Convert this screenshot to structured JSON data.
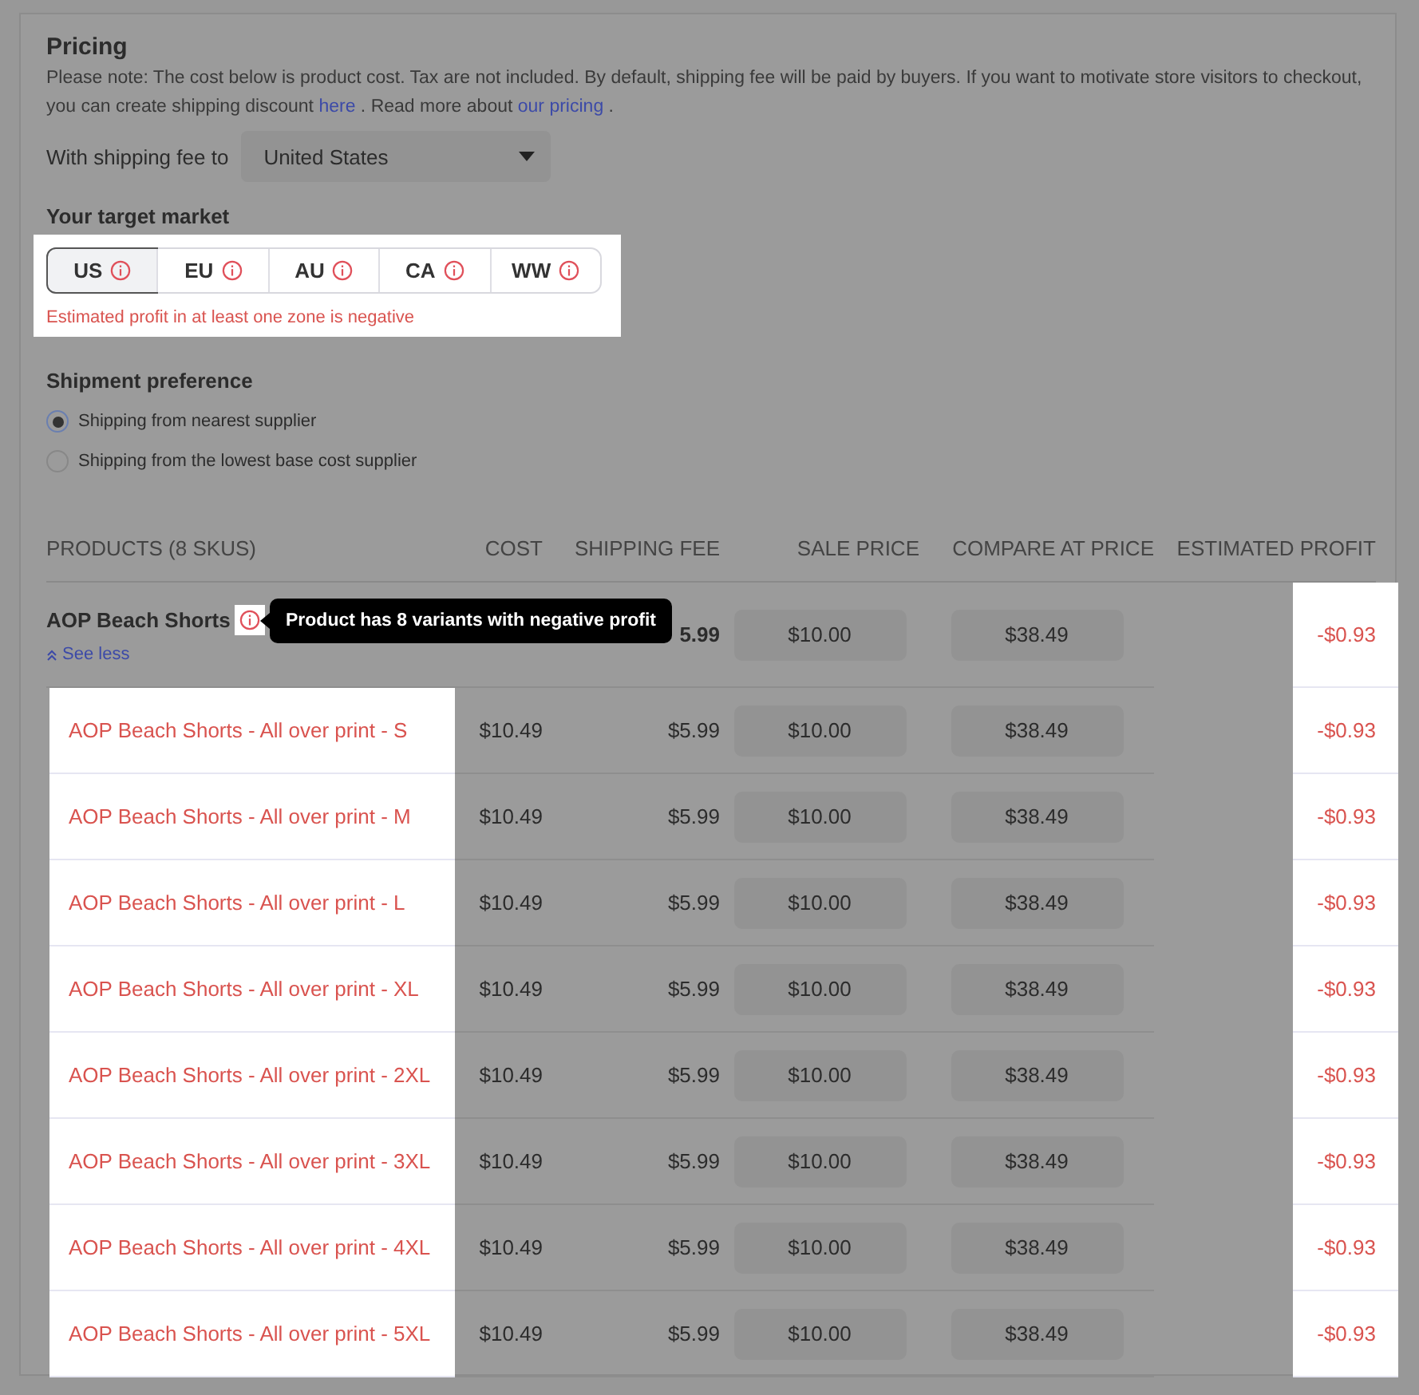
{
  "pricing": {
    "title": "Pricing",
    "note": {
      "before": "Please note: The cost below is product cost. Tax are not included. By default, shipping fee will be paid by buyers. If you want to motivate store visitors to checkout, you can create shipping discount ",
      "link1": "here",
      "middle": " . Read more about ",
      "link2": "our pricing",
      "after": " ."
    }
  },
  "shipping_to": {
    "label": "With shipping fee to",
    "value": "United States"
  },
  "target_market": {
    "label": "Your target market",
    "tabs": [
      {
        "label": "US",
        "selected": true
      },
      {
        "label": "EU",
        "selected": false
      },
      {
        "label": "AU",
        "selected": false
      },
      {
        "label": "CA",
        "selected": false
      },
      {
        "label": "WW",
        "selected": false
      }
    ],
    "warning": "Estimated profit in at least one zone is negative"
  },
  "shipment": {
    "label": "Shipment preference",
    "options": [
      {
        "label": "Shipping from nearest supplier",
        "selected": true
      },
      {
        "label": "Shipping from the lowest base cost supplier",
        "selected": false
      }
    ]
  },
  "table": {
    "columns": [
      "PRODUCTS (8 SKUS)",
      "COST",
      "SHIPPING FEE",
      "SALE PRICE",
      "COMPARE AT PRICE",
      "ESTIMATED PROFIT"
    ],
    "product": {
      "name": "AOP Beach Shorts",
      "link": "See less",
      "tooltip": "Product has 8 variants with negative profit",
      "shipping_fee": "5.99",
      "sale_price": "$10.00",
      "compare_at_price": "$38.49",
      "estimated_profit": "-$0.93"
    },
    "rows": [
      {
        "name": "AOP Beach Shorts - All over print - S",
        "cost": "$10.49",
        "shipping_fee": "$5.99",
        "sale_price": "$10.00",
        "compare_at_price": "$38.49",
        "estimated_profit": "-$0.93"
      },
      {
        "name": "AOP Beach Shorts - All over print - M",
        "cost": "$10.49",
        "shipping_fee": "$5.99",
        "sale_price": "$10.00",
        "compare_at_price": "$38.49",
        "estimated_profit": "-$0.93"
      },
      {
        "name": "AOP Beach Shorts - All over print - L",
        "cost": "$10.49",
        "shipping_fee": "$5.99",
        "sale_price": "$10.00",
        "compare_at_price": "$38.49",
        "estimated_profit": "-$0.93"
      },
      {
        "name": "AOP Beach Shorts - All over print - XL",
        "cost": "$10.49",
        "shipping_fee": "$5.99",
        "sale_price": "$10.00",
        "compare_at_price": "$38.49",
        "estimated_profit": "-$0.93"
      },
      {
        "name": "AOP Beach Shorts - All over print - 2XL",
        "cost": "$10.49",
        "shipping_fee": "$5.99",
        "sale_price": "$10.00",
        "compare_at_price": "$38.49",
        "estimated_profit": "-$0.93"
      },
      {
        "name": "AOP Beach Shorts - All over print - 3XL",
        "cost": "$10.49",
        "shipping_fee": "$5.99",
        "sale_price": "$10.00",
        "compare_at_price": "$38.49",
        "estimated_profit": "-$0.93"
      },
      {
        "name": "AOP Beach Shorts - All over print - 4XL",
        "cost": "$10.49",
        "shipping_fee": "$5.99",
        "sale_price": "$10.00",
        "compare_at_price": "$38.49",
        "estimated_profit": "-$0.93"
      },
      {
        "name": "AOP Beach Shorts - All over print - 5XL",
        "cost": "$10.49",
        "shipping_fee": "$5.99",
        "sale_price": "$10.00",
        "compare_at_price": "$38.49",
        "estimated_profit": "-$0.93"
      }
    ]
  }
}
